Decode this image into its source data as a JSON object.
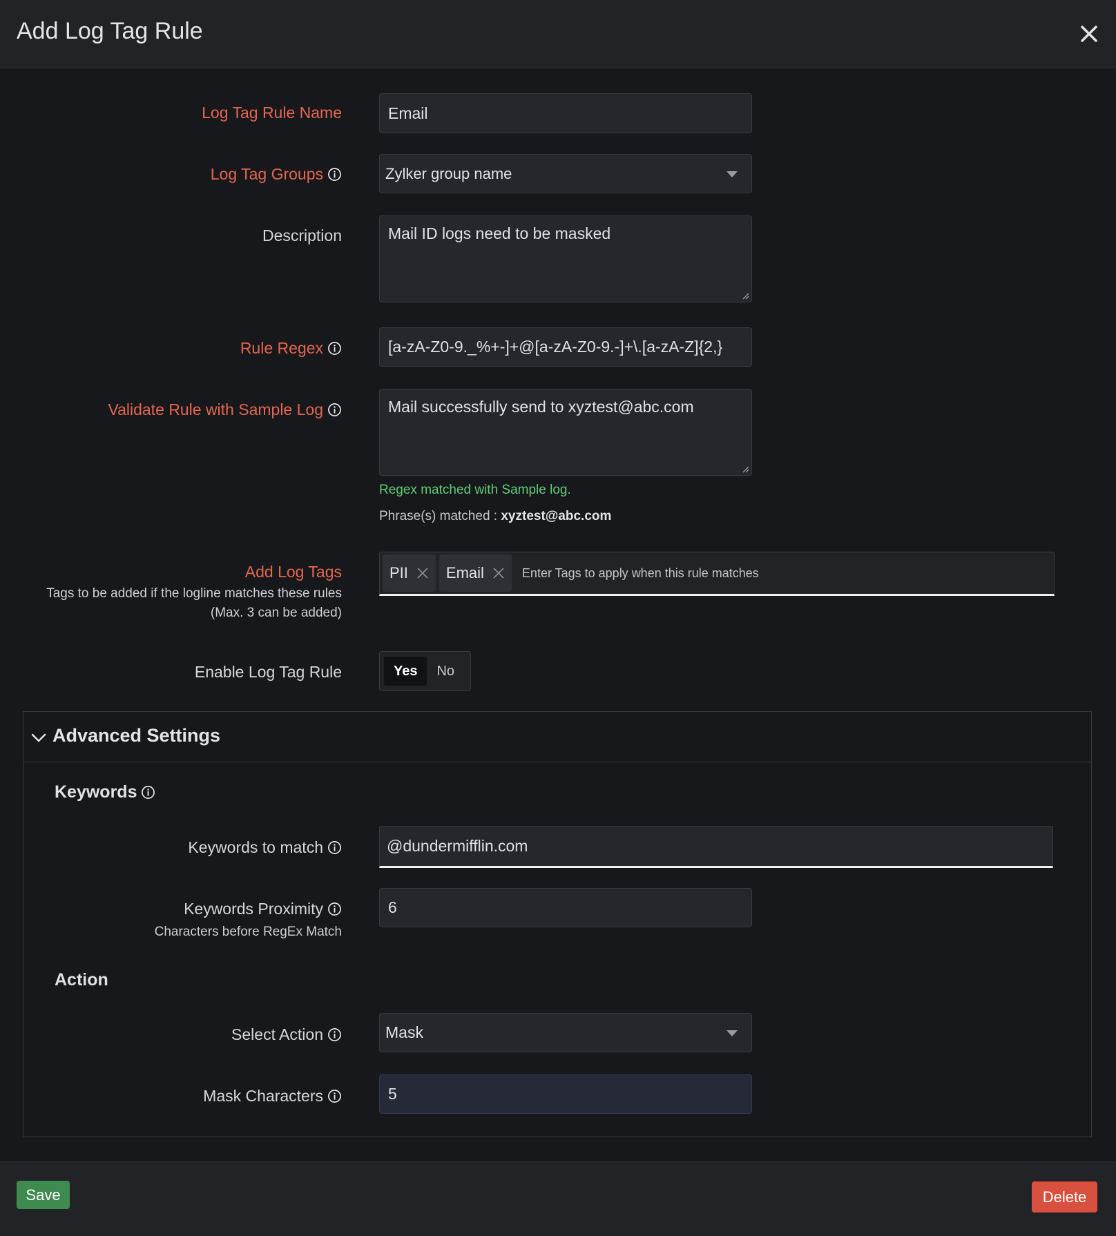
{
  "dialog": {
    "title": "Add Log Tag Rule",
    "close_icon": "close-icon"
  },
  "form": {
    "rule_name": {
      "label": "Log Tag Rule Name",
      "value": "Email"
    },
    "groups": {
      "label": "Log Tag Groups",
      "value": "Zylker group name"
    },
    "description": {
      "label": "Description",
      "value": "Mail ID logs need to be masked"
    },
    "regex": {
      "label": "Rule Regex",
      "value": "[a-zA-Z0-9._%+-]+@[a-zA-Z0-9.-]+\\.[a-zA-Z]{2,}"
    },
    "sample": {
      "label": "Validate Rule with Sample Log",
      "value": "Mail successfully send to xyztest@abc.com",
      "match_message": "Regex matched with Sample log.",
      "phrase_label": "Phrase(s) matched :",
      "phrase_value": "xyztest@abc.com"
    },
    "tags": {
      "label": "Add Log Tags",
      "sub1": "Tags to be added if the logline matches these rules",
      "sub2": "(Max. 3 can be added)",
      "chips": [
        "PII",
        "Email"
      ],
      "placeholder": "Enter Tags to apply when this rule matches"
    },
    "enable": {
      "label": "Enable Log Tag Rule",
      "yes": "Yes",
      "no": "No",
      "selected": "Yes"
    }
  },
  "advanced": {
    "title": "Advanced Settings",
    "keywords_section": "Keywords",
    "keywords": {
      "label": "Keywords to match",
      "value": "@dundermifflin.com"
    },
    "proximity": {
      "label": "Keywords Proximity",
      "sub": "Characters before RegEx Match",
      "value": "6"
    },
    "action_section": "Action",
    "action": {
      "label": "Select Action",
      "value": "Mask"
    },
    "mask": {
      "label": "Mask Characters",
      "value": "5"
    }
  },
  "footer": {
    "save": "Save",
    "delete": "Delete"
  },
  "colors": {
    "required": "#e5674f",
    "success": "#5fcf74",
    "save": "#3f8a4f",
    "delete": "#d9503f"
  }
}
